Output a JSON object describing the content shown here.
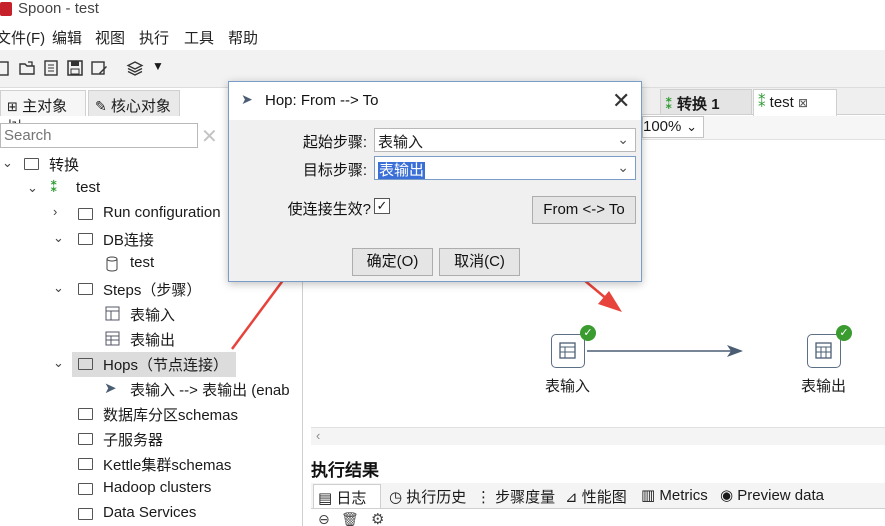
{
  "window": {
    "title": "Spoon - test"
  },
  "menu": [
    "文件(F)",
    "编辑",
    "视图",
    "执行",
    "工具",
    "帮助"
  ],
  "left_tabs": [
    "主对象树",
    "核心对象"
  ],
  "search": {
    "placeholder": "Search"
  },
  "tree": {
    "root": "转换",
    "trans": "test",
    "run_config": "Run configuration",
    "db_conn": "DB连接",
    "db_test": "test",
    "steps": "Steps（步骤）",
    "step_in": "表输入",
    "step_out": "表输出",
    "hops": "Hops（节点连接）",
    "hop_item": "表输入 --> 表输出 (enab",
    "partition": "数据库分区schemas",
    "slave": "子服务器",
    "cluster": "Kettle集群schemas",
    "hadoop": "Hadoop clusters",
    "data_services": "Data Services"
  },
  "editor_tabs": [
    "转换 1",
    "test"
  ],
  "zoom": "100%",
  "canvas": {
    "step1": "表输入",
    "step2": "表输出"
  },
  "results": {
    "title": "执行结果",
    "tabs": [
      "日志",
      "执行历史",
      "步骤度量",
      "性能图",
      "Metrics",
      "Preview data"
    ]
  },
  "dialog": {
    "title": "Hop: From --> To",
    "from_label": "起始步骤:",
    "from_value": "表输入",
    "to_label": "目标步骤:",
    "to_value": "表输出",
    "enable_label": "使连接生效?",
    "enable_checked": true,
    "swap_button": "From <-> To",
    "ok_button": "确定(O)",
    "cancel_button": "取消(C)"
  },
  "colors": {
    "accent": "#3a6fd8",
    "arrow": "#e8433b",
    "check": "#3a9b2f"
  }
}
